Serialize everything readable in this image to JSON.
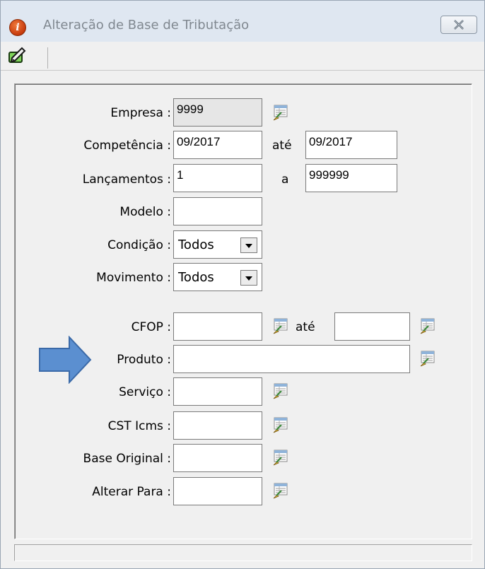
{
  "window": {
    "title": "Alteração de Base de Tributação"
  },
  "icons": {
    "app": "info-icon",
    "close": "close-x-icon",
    "toolbar_edit": "edit-pencil-icon",
    "lookup": "table-lookup-icon",
    "pointer": "blue-arrow-icon"
  },
  "form": {
    "empresa": {
      "label": "Empresa :",
      "value": "9999"
    },
    "competencia": {
      "label": "Competência :",
      "from": "09/2017",
      "sep": "até",
      "to": "09/2017"
    },
    "lancamentos": {
      "label": "Lançamentos :",
      "from": "1",
      "sep": "a",
      "to": "999999"
    },
    "modelo": {
      "label": "Modelo :",
      "value": ""
    },
    "condicao": {
      "label": "Condição :",
      "value": "Todos"
    },
    "movimento": {
      "label": "Movimento :",
      "value": "Todos"
    },
    "cfop": {
      "label": "CFOP :",
      "from": "",
      "sep": "até",
      "to": ""
    },
    "produto": {
      "label": "Produto :",
      "value": ""
    },
    "servico": {
      "label": "Serviço :",
      "value": ""
    },
    "cst_icms": {
      "label": "CST Icms :",
      "value": ""
    },
    "base_original": {
      "label": "Base Original :",
      "value": ""
    },
    "alterar_para": {
      "label": "Alterar Para :",
      "value": ""
    }
  },
  "colors": {
    "annotation_arrow": "#5b8fd0",
    "annotation_arrow_border": "#3b6aa8"
  }
}
